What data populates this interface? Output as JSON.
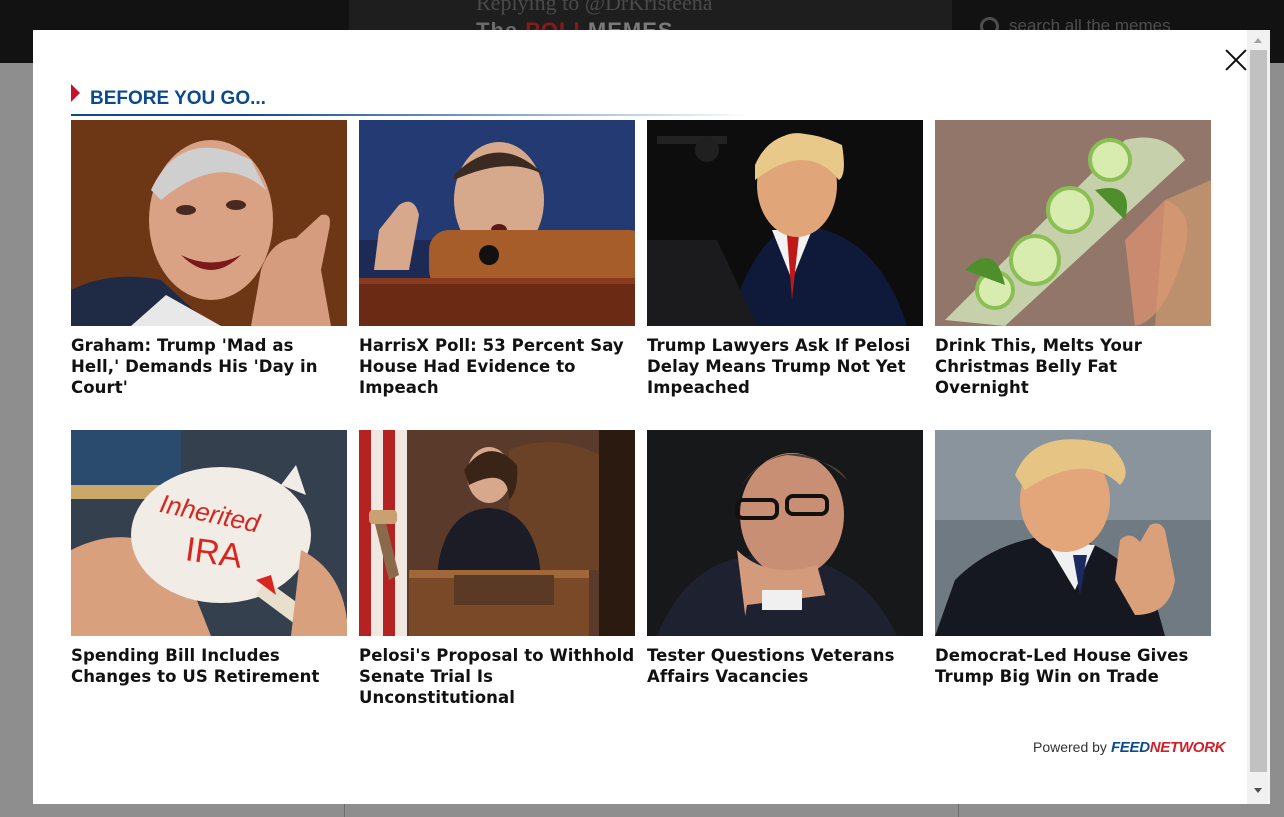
{
  "background_page": {
    "header_text": "Replying to @DrKristeena",
    "logo": {
      "part1": "The ",
      "part2": "POLL",
      "part3": "MEMES"
    },
    "search_placeholder": "search all the memes"
  },
  "modal": {
    "heading": "BEFORE YOU GO...",
    "powered_by": "Powered by",
    "brand": {
      "feed": "FEED",
      "network": "NETWORK"
    },
    "cards": [
      {
        "title": "Graham: Trump 'Mad as Hell,' Demands His 'Day in Court'",
        "image": "lindsey-graham-pointing"
      },
      {
        "title": "HarrisX Poll: 53 Percent Say House Had Evidence to Impeach",
        "image": "adam-schiff-speaking"
      },
      {
        "title": "Trump Lawyers Ask If Pelosi Delay Means Trump Not Yet Impeached",
        "image": "donald-trump-podium"
      },
      {
        "title": "Drink This, Melts Your Christmas Belly Fat Overnight",
        "image": "cucumber-water-bottle"
      },
      {
        "title": "Spending Bill Includes Changes to US Retirement",
        "image": "inherited-ira-piggy-bank"
      },
      {
        "title": "Pelosi's Proposal to Withhold Senate Trial Is Unconstitutional",
        "image": "nancy-pelosi-gavel"
      },
      {
        "title": "Tester Questions Veterans Affairs Vacancies",
        "image": "jon-tester-thinking"
      },
      {
        "title": "Democrat-Led House Gives Trump Big Win on Trade",
        "image": "donald-trump-thumbs-up"
      }
    ],
    "thumb_texts": {
      "ira_line1": "Inherited",
      "ira_line2": "IRA"
    }
  }
}
